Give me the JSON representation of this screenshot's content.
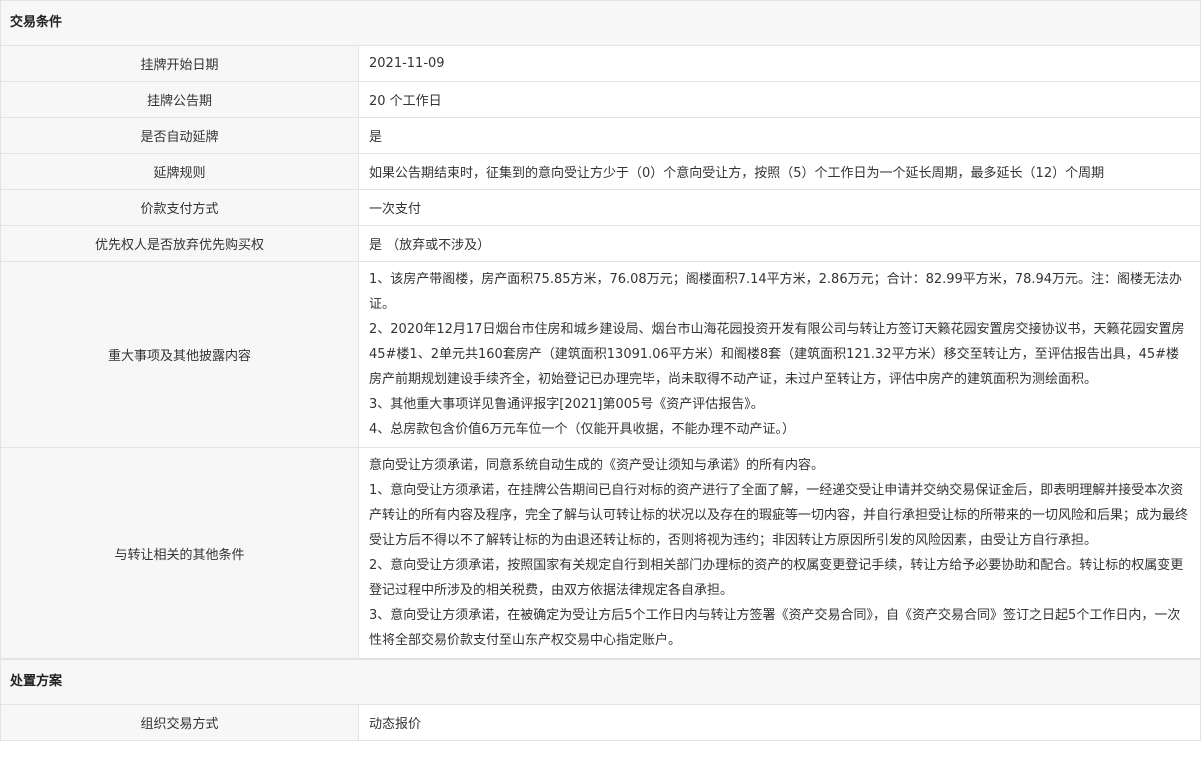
{
  "sections": [
    {
      "title": "交易条件",
      "rows": [
        {
          "label": "挂牌开始日期",
          "value": "2021-11-09"
        },
        {
          "label": "挂牌公告期",
          "value": "20 个工作日"
        },
        {
          "label": "是否自动延牌",
          "value": "是"
        },
        {
          "label": "延牌规则",
          "value": "如果公告期结束时，征集到的意向受让方少于（0）个意向受让方，按照（5）个工作日为一个延长周期，最多延长（12）个周期"
        },
        {
          "label": "价款支付方式",
          "value": "一次支付"
        },
        {
          "label": "优先权人是否放弃优先购买权",
          "value": "是 （放弃或不涉及）"
        },
        {
          "label": "重大事项及其他披露内容",
          "paragraphs": [
            "1、该房产带阁楼，房产面积75.85方米，76.08万元；阁楼面积7.14平方米，2.86万元；合计：82.99平方米，78.94万元。注：阁楼无法办证。",
            "2、2020年12月17日烟台市住房和城乡建设局、烟台市山海花园投资开发有限公司与转让方签订天籁花园安置房交接协议书，天籁花园安置房45#楼1、2单元共160套房产（建筑面积13091.06平方米）和阁楼8套（建筑面积121.32平方米）移交至转让方，至评估报告出具，45#楼房产前期规划建设手续齐全，初始登记已办理完毕，尚未取得不动产证，未过户至转让方，评估中房产的建筑面积为测绘面积。",
            "3、其他重大事项详见鲁通评报字[2021]第005号《资产评估报告》。",
            "4、总房款包含价值6万元车位一个（仅能开具收据，不能办理不动产证。）"
          ]
        },
        {
          "label": "与转让相关的其他条件",
          "paragraphs": [
            "意向受让方须承诺，同意系统自动生成的《资产受让须知与承诺》的所有内容。",
            "1、意向受让方须承诺，在挂牌公告期间已自行对标的资产进行了全面了解，一经递交受让申请并交纳交易保证金后，即表明理解并接受本次资产转让的所有内容及程序，完全了解与认可转让标的状况以及存在的瑕疵等一切内容，并自行承担受让标的所带来的一切风险和后果；成为最终受让方后不得以不了解转让标的为由退还转让标的，否则将视为违约；非因转让方原因所引发的风险因素，由受让方自行承担。",
            "2、意向受让方须承诺，按照国家有关规定自行到相关部门办理标的资产的权属变更登记手续，转让方给予必要协助和配合。转让标的权属变更登记过程中所涉及的相关税费，由双方依据法律规定各自承担。",
            "3、意向受让方须承诺，在被确定为受让方后5个工作日内与转让方签署《资产交易合同》，自《资产交易合同》签订之日起5个工作日内，一次性将全部交易价款支付至山东产权交易中心指定账户。"
          ]
        }
      ]
    },
    {
      "title": "处置方案",
      "rows": [
        {
          "label": "组织交易方式",
          "value": "动态报价"
        }
      ]
    }
  ]
}
